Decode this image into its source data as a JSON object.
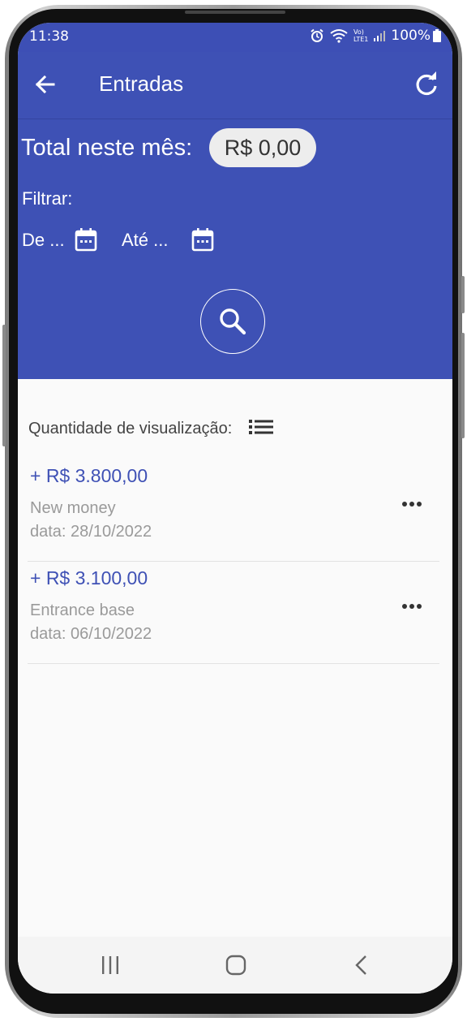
{
  "status_bar": {
    "time": "11:38",
    "battery": "100%",
    "network_label_top": "Vo)",
    "network_label_bottom": "LTE1"
  },
  "toolbar": {
    "title": "Entradas",
    "back_icon": "arrow-left-icon",
    "refresh_icon": "refresh-icon"
  },
  "summary": {
    "total_label": "Total neste mês:",
    "total_value": "R$ 0,00"
  },
  "filter": {
    "label": "Filtrar:",
    "from_label": "De ...",
    "to_label": "Até ...",
    "calendar_icon": "calendar-icon",
    "search_icon": "search-icon"
  },
  "list": {
    "quantity_label": "Quantidade de visualização:",
    "quantity_icon": "list-icon",
    "entries": [
      {
        "amount": "+  R$ 3.800,00",
        "name": "New money",
        "date": "data: 28/10/2022"
      },
      {
        "amount": "+  R$ 3.100,00",
        "name": "Entrance base",
        "date": "data: 06/10/2022"
      }
    ]
  },
  "colors": {
    "primary": "#3e51b5",
    "accent_text": "#3f51b5",
    "background": "#fafafa"
  }
}
